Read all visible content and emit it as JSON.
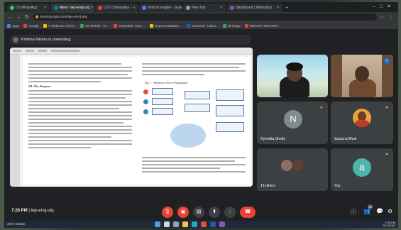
{
  "browser": {
    "tabs": [
      {
        "label": "(7) WhatsApp",
        "color": "#25d366"
      },
      {
        "label": "Meet - iwy-ensj-utq",
        "color": "#00897b"
      },
      {
        "label": "(27) Chitrakatha -",
        "color": "#ea4335"
      },
      {
        "label": "hindi to english - Google S",
        "color": "#4285f4"
      },
      {
        "label": "New Tab",
        "color": "#9aa0a6"
      },
      {
        "label": "Dashboard | Workshop",
        "color": "#7e57c2"
      }
    ],
    "url": "meet.google.com/iwy-ensj-utq",
    "bookmarks": [
      {
        "label": "Apps",
        "color": "#4285f4"
      },
      {
        "label": "Google",
        "color": "#ea4335"
      },
      {
        "label": "A Textbook of Hist...",
        "color": "#fbbc05"
      },
      {
        "label": "NI: EdTalk - Yo...",
        "color": "#34a853"
      },
      {
        "label": "September 2017 ...",
        "color": "#ea4335"
      },
      {
        "label": "Report Database ...",
        "color": "#fbbc05"
      },
      {
        "label": "sanchetit - LinkIn...",
        "color": "#0a66c2"
      },
      {
        "label": "all image",
        "color": "#34a853"
      },
      {
        "label": "REPORT RECORD ...",
        "color": "#ea4335"
      }
    ]
  },
  "meet": {
    "presenter_banner": "Krishna Mishra is presenting",
    "figure_title": "Fig. 1 - Reference Test of Preparation",
    "doc_heading": "III. The Purpose",
    "participants": [
      {
        "name": "",
        "type": "camera"
      },
      {
        "name": "",
        "type": "camera"
      },
      {
        "name": "Nyvedita Shetty",
        "initial": "N",
        "type": "avatar",
        "color": "#7f8c8d"
      },
      {
        "name": "Suvarna Bhoir",
        "initial": "",
        "type": "photo",
        "color": "#e8a33c"
      },
      {
        "name": "13 others",
        "type": "group"
      },
      {
        "name": "You",
        "initial": "a",
        "type": "avatar",
        "color": "#4db6ac"
      }
    ],
    "time": "7:26 PM",
    "meeting_code": "iwy-ensj-utq",
    "participant_count": "13",
    "chat_count": ""
  },
  "taskbar": {
    "weather": "33°C Smoke",
    "time": "7:26 PM",
    "date": "2/10/2022"
  }
}
